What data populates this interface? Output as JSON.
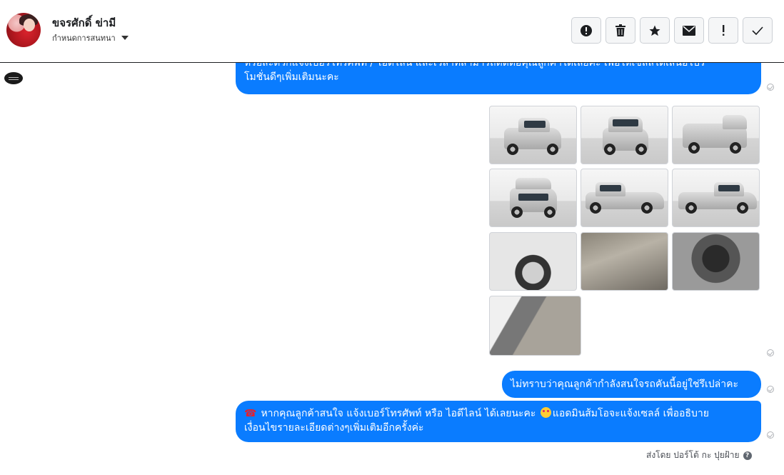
{
  "header": {
    "name": "ขจรศักดิ์ ข่ามี",
    "assign_label": "กำหนดการสนทนา",
    "actions": [
      {
        "icon": "alert-circle-icon",
        "name": "mark-spam-button"
      },
      {
        "icon": "trash-icon",
        "name": "delete-button"
      },
      {
        "icon": "star-icon",
        "name": "star-button"
      },
      {
        "icon": "envelope-icon",
        "name": "mark-unread-button"
      },
      {
        "icon": "exclamation-icon",
        "name": "follow-up-button"
      },
      {
        "icon": "check-icon",
        "name": "mark-done-button"
      }
    ]
  },
  "messages": {
    "msg1_line1": "หรือสะดวกแจ้งเบอร์โทรศัพท์ / ไอดีไลน์ และเวลาที่สามารถติดต่อคุณลูกค้าได้เลยค่ะ เพื่อให้เซลล์ได้เสนอโปร",
    "msg1_line2": "โมชั่นดีๆเพิ่มเติมนะคะ",
    "msg2": "ไม่ทราบว่าคุณลูกค้ากำลังสนใจรถคันนี้อยู่ใช่รึเปล่าคะ",
    "msg3_part1": "หากคุณลูกค้าสนใจ แจ้งเบอร์โทรศัพท์ หรือ ไอดีไลน์  ได้เลยนะคะ",
    "msg3_part2": "แอดมินส้มโอจะแจ้งเซลล์   เพื่ออธิบาย",
    "msg3_line2": "เงื่อนไขรายละเอียดต่างๆเพิ่มเติมอีกครั้งค่ะ",
    "phone_icon": "☎"
  },
  "photos": [
    {
      "kind": "car-front-left"
    },
    {
      "kind": "car-front"
    },
    {
      "kind": "car-rear-right"
    },
    {
      "kind": "car-rear"
    },
    {
      "kind": "car-side-left"
    },
    {
      "kind": "car-side-right"
    },
    {
      "kind": "wheel-closeup"
    },
    {
      "kind": "interior-gearstick"
    },
    {
      "kind": "engine-bay"
    },
    {
      "kind": "interior-seats"
    }
  ],
  "footer": {
    "sent_by": "ส่งโดย ปอร์โต้ กะ ปุยฝ้าย"
  }
}
